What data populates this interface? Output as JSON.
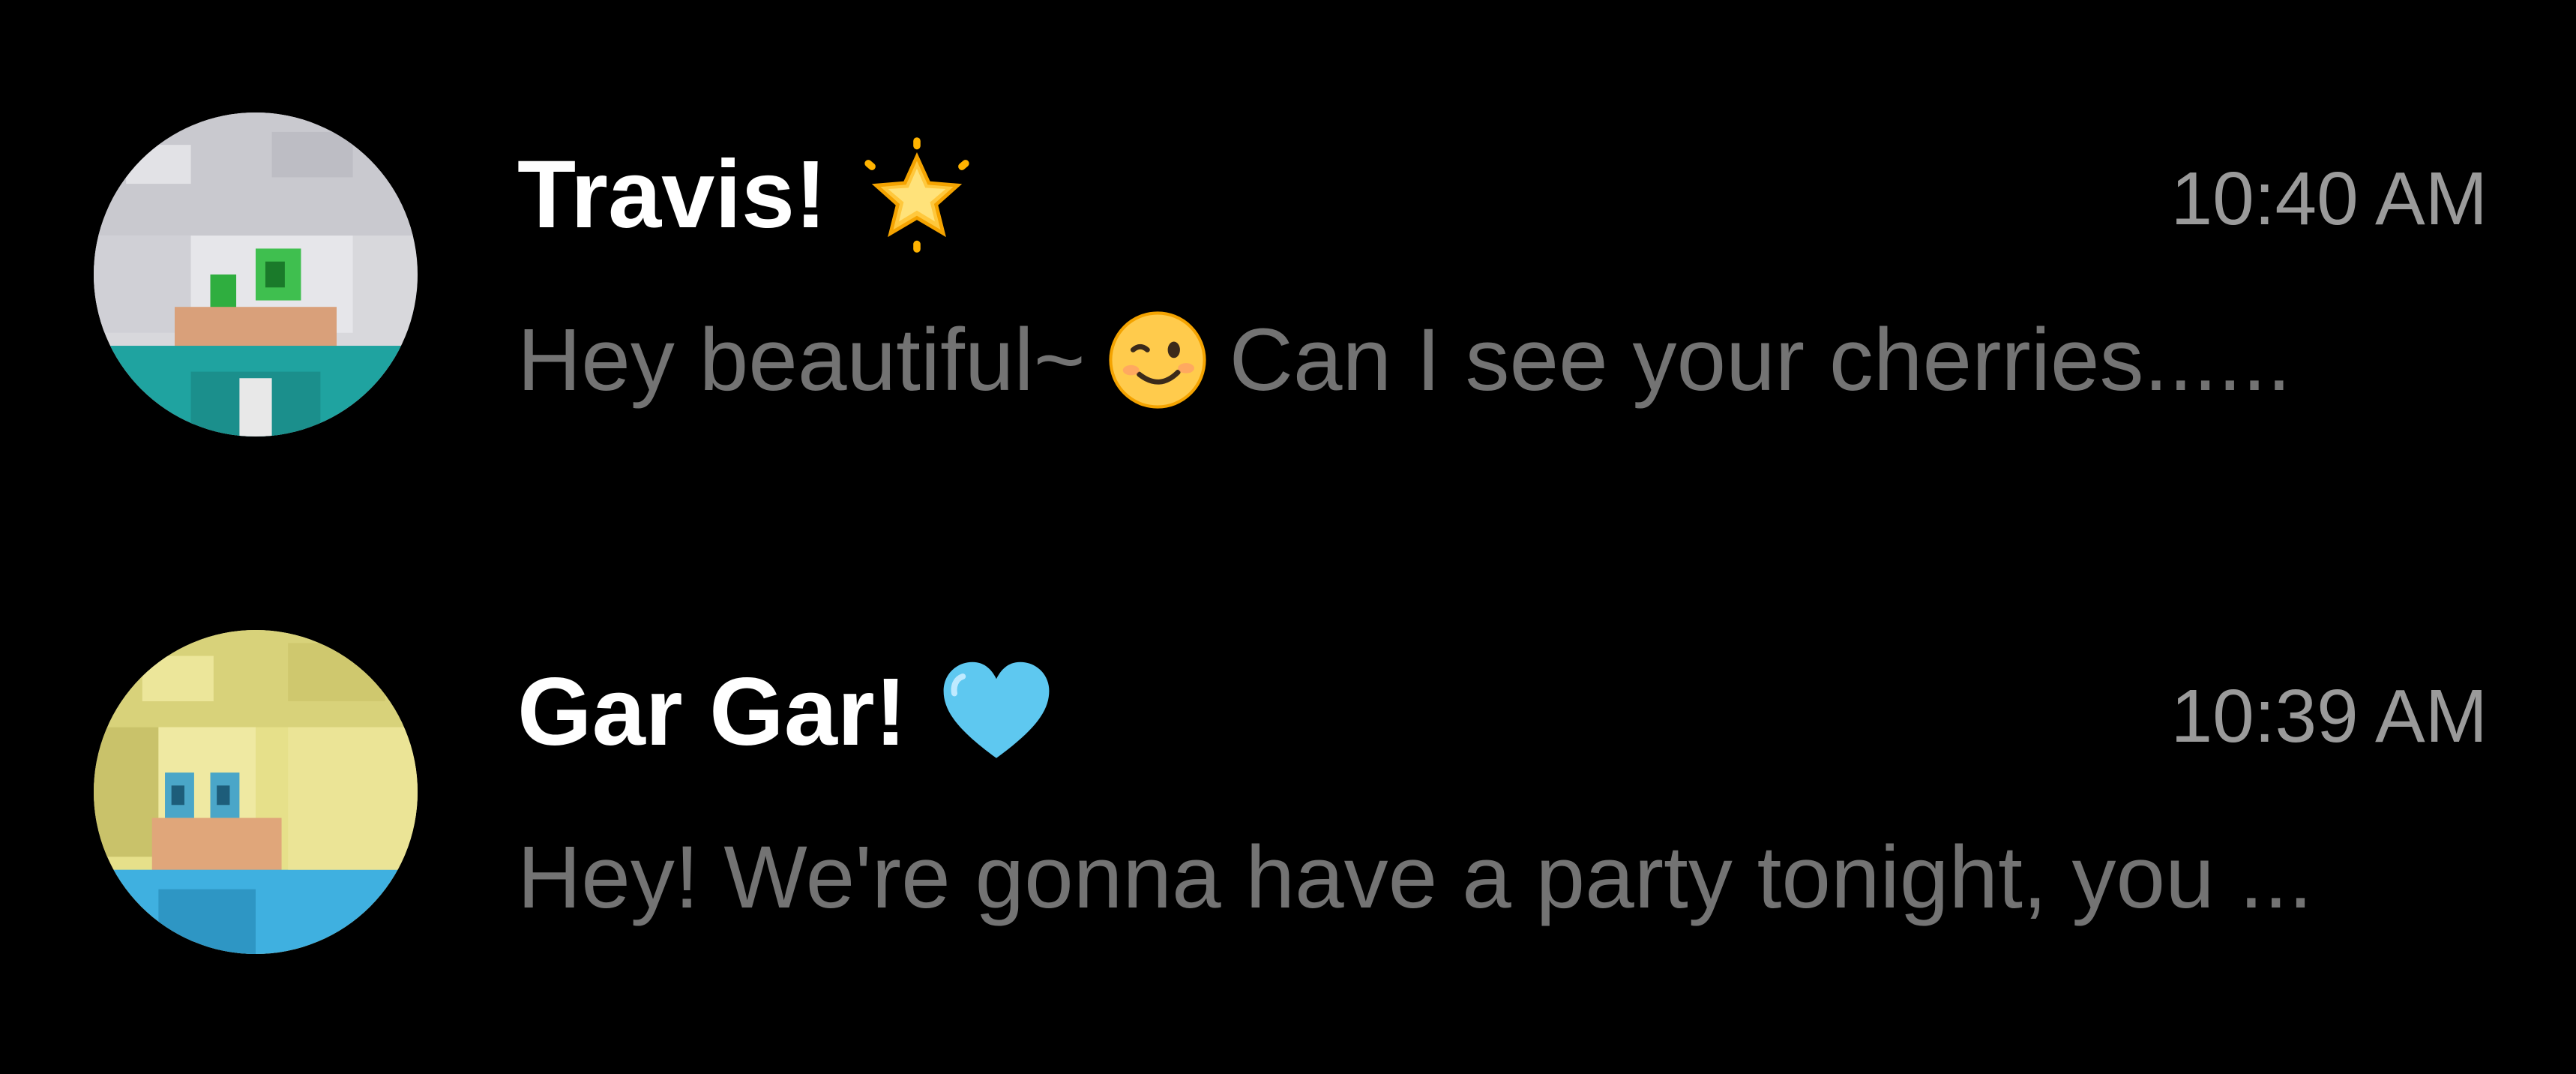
{
  "chats": [
    {
      "name": "Travis!",
      "name_emoji": "glowing-star-icon",
      "time": "10:40 AM",
      "preview_before_emoji": "Hey beautiful~",
      "preview_emoji": "winking-face-icon",
      "preview_after_emoji": "Can I see your cherries......",
      "avatar": "avatar-icon"
    },
    {
      "name": "Gar Gar!",
      "name_emoji": "light-blue-heart-icon",
      "time": "10:39 AM",
      "preview": "Hey! We're gonna have a party tonight, you ...",
      "avatar": "avatar-icon"
    }
  ],
  "colors": {
    "background": "#000000",
    "name": "#ffffff",
    "time": "#9a9a9a",
    "preview": "#737373"
  }
}
